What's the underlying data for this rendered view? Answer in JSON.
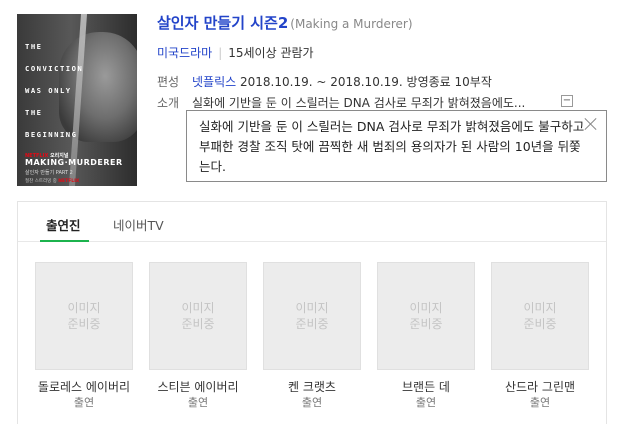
{
  "poster": {
    "tagline": "THE\nCONVICTION\nWAS ONLY\nTHE\nBEGINNING",
    "netflix": "NETFLIX",
    "original": "오리지널",
    "title": "MAKING·MURDERER",
    "subtitle": "살인자 만들기 PART 2",
    "footer": "절찬 스트리밍 중",
    "footer_brand": "NETFLIX"
  },
  "title": "살인자 만들기 시즌2",
  "title_en": "(Making a Murderer)",
  "meta": {
    "genre": "미국드라마",
    "rating": "15세이상 관람가"
  },
  "info": {
    "org_label": "편성",
    "org_link": "넷플릭스",
    "org_value": "2018.10.19. ~ 2018.10.19. 방영종료 10부작",
    "intro_label": "소개",
    "intro_value": "실화에 기반을 둔 이 스릴러는 DNA 검사로 무죄가 밝혀졌음에도...",
    "expand_symbol": "−"
  },
  "popup": {
    "text": "실화에 기반을 둔 이 스릴러는 DNA 검사로 무죄가 밝혀졌음에도 불구하고 부패한 경찰 조직 탓에 끔찍한 새 범죄의 용의자가 된 사람의 10년을 뒤쫓는다."
  },
  "tabs": [
    {
      "label": "출연진",
      "active": true
    },
    {
      "label": "네이버TV",
      "active": false
    }
  ],
  "cast": [
    {
      "placeholder": "이미지\n준비중",
      "name": "돌로레스 에이버리",
      "role": "출연"
    },
    {
      "placeholder": "이미지\n준비중",
      "name": "스티븐 에이버리",
      "role": "출연"
    },
    {
      "placeholder": "이미지\n준비중",
      "name": "켄 크랫츠",
      "role": "출연"
    },
    {
      "placeholder": "이미지\n준비중",
      "name": "브랜든 데",
      "role": "출연"
    },
    {
      "placeholder": "이미지\n준비중",
      "name": "산드라 그린맨",
      "role": "출연"
    }
  ]
}
